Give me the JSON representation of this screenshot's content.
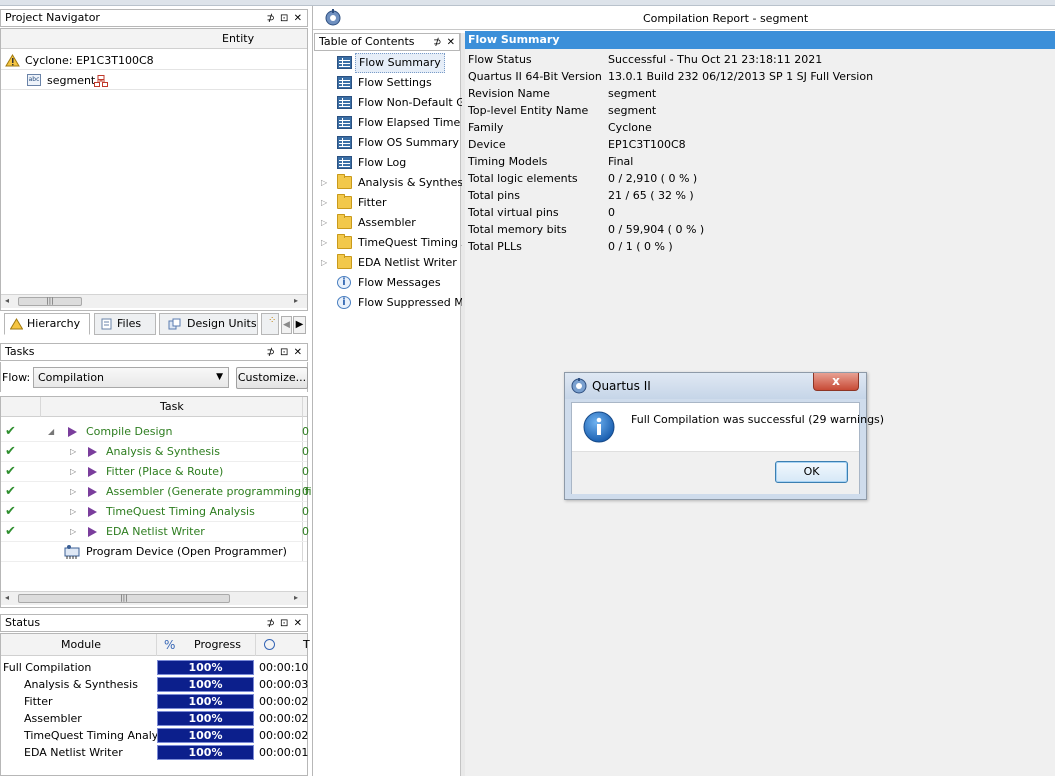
{
  "navigator": {
    "title": "Project Navigator",
    "controls": "⊅ ⊡ ✕",
    "column": "Entity",
    "device": "Cyclone: EP1C3T100C8",
    "entity": "segment",
    "tabs": [
      "Hierarchy",
      "Files",
      "Design Units"
    ]
  },
  "tasks": {
    "title": "Tasks",
    "flow_label": "Flow:",
    "flow_value": "Compilation",
    "customize_label": "Customize...",
    "column": "Task",
    "items": [
      {
        "label": "Compile Design",
        "status": "done",
        "tail": "0"
      },
      {
        "label": "Analysis & Synthesis",
        "status": "done",
        "tail": "0"
      },
      {
        "label": "Fitter (Place & Route)",
        "status": "done",
        "tail": "0"
      },
      {
        "label": "Assembler (Generate programming files)",
        "status": "done",
        "tail": "0"
      },
      {
        "label": "TimeQuest Timing Analysis",
        "status": "done",
        "tail": "0"
      },
      {
        "label": "EDA Netlist Writer",
        "status": "done",
        "tail": "0"
      },
      {
        "label": "Program Device (Open Programmer)",
        "status": "none",
        "tail": ""
      }
    ]
  },
  "status": {
    "title": "Status",
    "col_module": "Module",
    "col_pct": "%",
    "col_progress": "Progress",
    "col_t": "T",
    "rows": [
      {
        "module": "Full Compilation",
        "progress": "100%",
        "progress_fraction": 1.0,
        "time": "00:00:10"
      },
      {
        "module": "Analysis & Synthesis",
        "progress": "100%",
        "progress_fraction": 1.0,
        "time": "00:00:03"
      },
      {
        "module": "Fitter",
        "progress": "100%",
        "progress_fraction": 1.0,
        "time": "00:00:02"
      },
      {
        "module": "Assembler",
        "progress": "100%",
        "progress_fraction": 1.0,
        "time": "00:00:02"
      },
      {
        "module": "TimeQuest Timing Analyzer",
        "progress": "100%",
        "progress_fraction": 1.0,
        "time": "00:00:02"
      },
      {
        "module": "EDA Netlist Writer",
        "progress": "100%",
        "progress_fraction": 1.0,
        "time": "00:00:01"
      }
    ]
  },
  "report": {
    "title": "Compilation Report - segment",
    "toc_title": "Table of Contents",
    "toc": [
      {
        "label": "Flow Summary",
        "icon": "grid"
      },
      {
        "label": "Flow Settings",
        "icon": "grid"
      },
      {
        "label": "Flow Non-Default Global Settings",
        "icon": "grid"
      },
      {
        "label": "Flow Elapsed Time",
        "icon": "grid"
      },
      {
        "label": "Flow OS Summary",
        "icon": "grid"
      },
      {
        "label": "Flow Log",
        "icon": "grid"
      },
      {
        "label": "Analysis & Synthesis",
        "icon": "folder"
      },
      {
        "label": "Fitter",
        "icon": "folder"
      },
      {
        "label": "Assembler",
        "icon": "folder"
      },
      {
        "label": "TimeQuest Timing Analyzer",
        "icon": "folder"
      },
      {
        "label": "EDA Netlist Writer",
        "icon": "folder"
      },
      {
        "label": "Flow Messages",
        "icon": "info"
      },
      {
        "label": "Flow Suppressed Messages",
        "icon": "info"
      }
    ],
    "summary_title": "Flow Summary",
    "summary": [
      {
        "key": "Flow Status",
        "value": "Successful - Thu Oct 21 23:18:11 2021"
      },
      {
        "key": "Quartus II 64-Bit Version",
        "value": "13.0.1 Build 232 06/12/2013 SP 1 SJ Full Version"
      },
      {
        "key": "Revision Name",
        "value": "segment"
      },
      {
        "key": "Top-level Entity Name",
        "value": "segment"
      },
      {
        "key": "Family",
        "value": "Cyclone"
      },
      {
        "key": "Device",
        "value": "EP1C3T100C8"
      },
      {
        "key": "Timing Models",
        "value": "Final"
      },
      {
        "key": "Total logic elements",
        "value": "0 / 2,910 ( 0 % )"
      },
      {
        "key": "Total pins",
        "value": "21 / 65 ( 32 % )"
      },
      {
        "key": "Total virtual pins",
        "value": "0"
      },
      {
        "key": "Total memory bits",
        "value": "0 / 59,904 ( 0 % )"
      },
      {
        "key": "Total PLLs",
        "value": "0 / 1 ( 0 % )"
      }
    ]
  },
  "dialog": {
    "title": "Quartus II",
    "message": "Full Compilation was successful (29 warnings)",
    "ok_label": "OK",
    "close_label": "x"
  }
}
